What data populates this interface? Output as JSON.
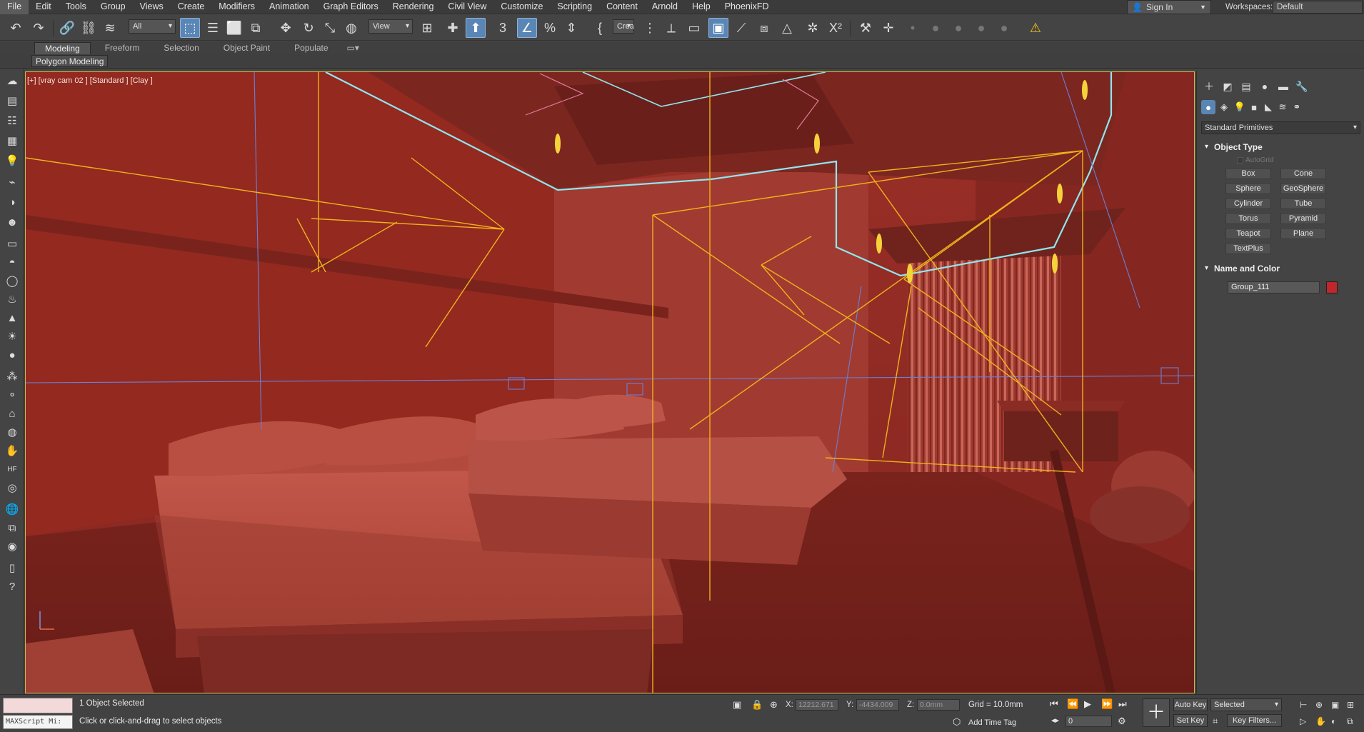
{
  "menu": {
    "items": [
      "File",
      "Edit",
      "Tools",
      "Group",
      "Views",
      "Create",
      "Modifiers",
      "Animation",
      "Graph Editors",
      "Rendering",
      "Civil View",
      "Customize",
      "Scripting",
      "Content",
      "Arnold",
      "Help",
      "PhoenixFD"
    ],
    "sign_in": "Sign In",
    "workspaces_label": "Workspaces:",
    "workspaces_value": "Default"
  },
  "toolbar": {
    "filter_value": "All",
    "ref_coord_value": "View",
    "named_sel_value": "Crea"
  },
  "ribbon": {
    "tabs": [
      "Modeling",
      "Freeform",
      "Selection",
      "Object Paint",
      "Populate"
    ],
    "active_tab": "Modeling",
    "sub_label": "Polygon Modeling"
  },
  "viewport": {
    "label": "[+] [vray cam 02 ] [Standard ] [Clay ]",
    "background": "#8c2a22"
  },
  "command_panel": {
    "category": "Standard Primitives",
    "object_type_title": "Object Type",
    "autogrid_label": "AutoGrid",
    "primitives": [
      "Box",
      "Cone",
      "Sphere",
      "GeoSphere",
      "Cylinder",
      "Tube",
      "Torus",
      "Pyramid",
      "Teapot",
      "Plane",
      "TextPlus"
    ],
    "name_color_title": "Name and Color",
    "object_name": "Group_111",
    "object_color": "#c0262b"
  },
  "status": {
    "maxscript": "MAXScript Mi:",
    "selection_count": "1 Object Selected",
    "prompt": "Click or click-and-drag to select objects",
    "x_label": "X:",
    "x_value": "12212.671",
    "y_label": "Y:",
    "y_value": "-4434.009",
    "z_label": "Z:",
    "z_value": "0.0mm",
    "grid": "Grid = 10.0mm",
    "add_time_tag": "Add Time Tag",
    "frame": "0",
    "auto_key": "Auto Key",
    "set_key": "Set Key",
    "selected_value": "Selected",
    "key_filters": "Key Filters..."
  }
}
